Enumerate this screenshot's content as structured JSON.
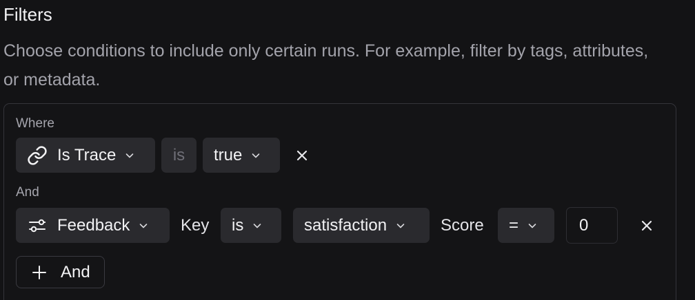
{
  "header": {
    "title": "Filters",
    "description": "Choose conditions to include only certain runs. For example, filter by tags, attributes, or metadata."
  },
  "filters": {
    "where_label": "Where",
    "and_label": "And",
    "row1": {
      "field": {
        "label": "Is Trace",
        "icon": "link-icon"
      },
      "operator": "is",
      "value": "true",
      "remove_icon": "close-icon"
    },
    "row2": {
      "field": {
        "label": "Feedback",
        "icon": "sliders-icon"
      },
      "key_label": "Key",
      "key_operator": "is",
      "key_value": "satisfaction",
      "score_label": "Score",
      "score_operator": "=",
      "score_value": "0",
      "remove_icon": "close-icon"
    },
    "add_button": {
      "label": "And",
      "icon": "plus-icon"
    }
  }
}
